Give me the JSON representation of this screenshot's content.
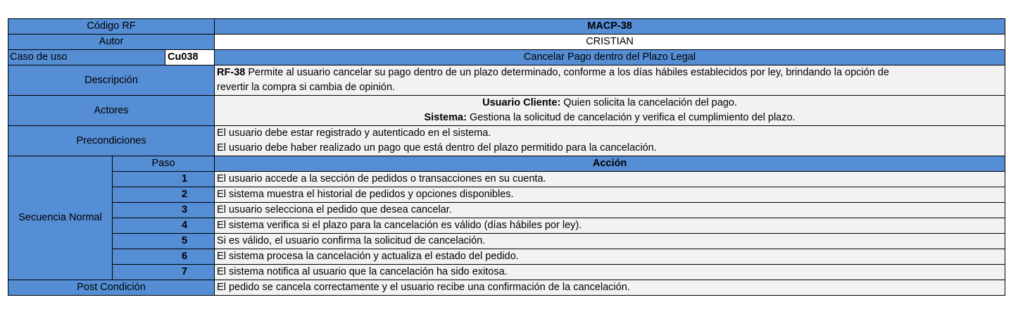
{
  "header": {
    "codigo_label": "Código RF",
    "codigo_value": "MACP-38",
    "autor_label": "Autor",
    "autor_value": "CRISTIAN",
    "caso_label": "Caso de uso",
    "caso_code": "Cu038",
    "caso_value": "Cancelar Pago dentro del Plazo Legal"
  },
  "descripcion": {
    "label": "Descripción",
    "bold": "RF-38",
    "line1": " Permite al usuario cancelar su pago dentro de un plazo determinado, conforme a los días hábiles establecidos por ley, brindando la opción de",
    "line2": "revertir la compra si cambia de opinión."
  },
  "actores": {
    "label": "Actores",
    "a1_bold": "Usuario Cliente:",
    "a1_text": " Quien solicita la cancelación del pago.",
    "a2_bold": "Sistema:",
    "a2_text": " Gestiona la solicitud de cancelación y verifica el cumplimiento del plazo."
  },
  "precondiciones": {
    "label": "Precondiciones",
    "line1": "El usuario debe estar registrado y autenticado en el sistema.",
    "line2": "El usuario debe haber realizado un pago que está dentro del plazo permitido para la cancelación."
  },
  "secuencia": {
    "label": "Secuencia Normal",
    "paso_header": "Paso",
    "accion_header": "Acción",
    "steps": [
      {
        "n": "1",
        "text": "El usuario accede a la sección de pedidos o transacciones en su cuenta."
      },
      {
        "n": "2",
        "text": "El sistema muestra el historial de pedidos y opciones disponibles."
      },
      {
        "n": "3",
        "text": "El usuario selecciona el pedido que desea cancelar."
      },
      {
        "n": "4",
        "text": "El sistema verifica si el plazo para la cancelación es válido (días hábiles por ley)."
      },
      {
        "n": "5",
        "text": "Si es válido, el usuario confirma la solicitud de cancelación."
      },
      {
        "n": "6",
        "text": "El sistema procesa la cancelación y actualiza el estado del pedido."
      },
      {
        "n": "7",
        "text": "El sistema notifica al usuario que la cancelación ha sido exitosa."
      }
    ]
  },
  "post": {
    "label": "Post Condición",
    "text": "El pedido se cancela correctamente y el usuario recibe una confirmación de la cancelación."
  }
}
